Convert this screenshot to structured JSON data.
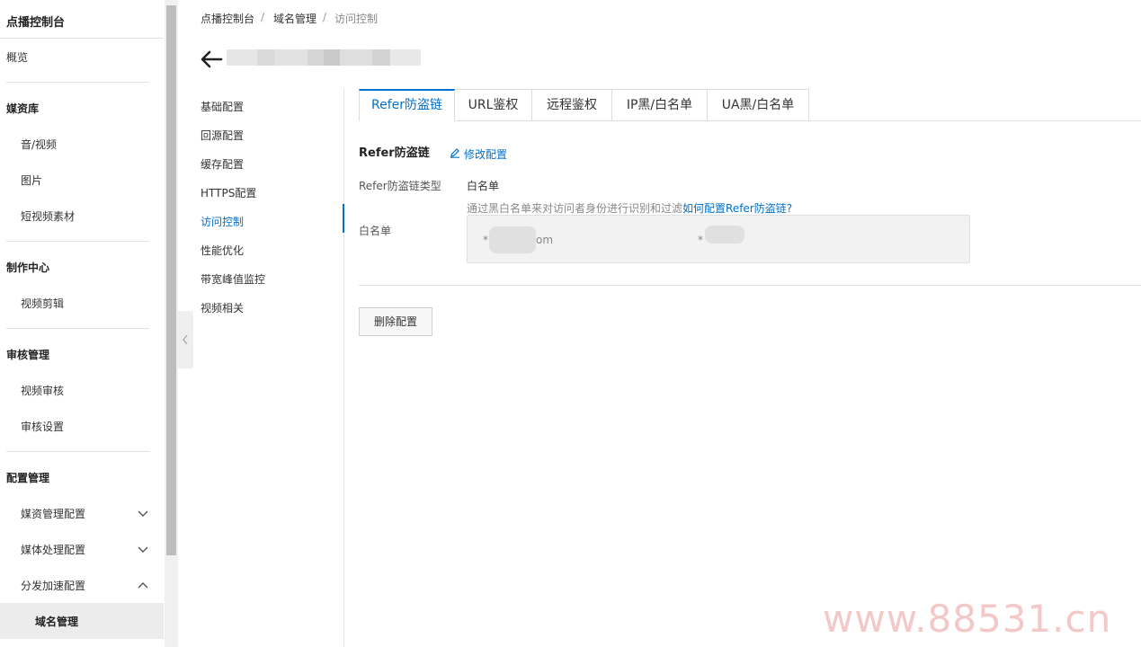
{
  "sidebar": {
    "title": "点播控制台",
    "overview": "概览",
    "groups": [
      {
        "label": "媒资库",
        "items": [
          "音/视频",
          "图片",
          "短视频素材"
        ]
      },
      {
        "label": "制作中心",
        "items": [
          "视频剪辑"
        ]
      },
      {
        "label": "审核管理",
        "items": [
          "视频审核",
          "审核设置"
        ]
      },
      {
        "label": "配置管理",
        "items": [
          "媒资管理配置",
          "媒体处理配置",
          "分发加速配置"
        ]
      }
    ],
    "active_item": "域名管理"
  },
  "breadcrumb": [
    "点播控制台",
    "域名管理",
    "访问控制"
  ],
  "breadcrumb_sep": "/",
  "sub_menu": [
    "基础配置",
    "回源配置",
    "缓存配置",
    "HTTPS配置",
    "访问控制",
    "性能优化",
    "带宽峰值监控",
    "视频相关"
  ],
  "sub_menu_active": "访问控制",
  "tabs": [
    "Refer防盗链",
    "URL鉴权",
    "远程鉴权",
    "IP黑/白名单",
    "UA黑/白名单"
  ],
  "active_tab": "Refer防盗链",
  "section": {
    "title": "Refer防盗链",
    "edit_label": "修改配置",
    "type_label": "Refer防盗链类型",
    "type_value": "白名单",
    "hint_text": "通过黑白名单来对访问者身份进行识别和过滤",
    "hint_link": "如何配置Refer防盗链?",
    "list_label": "白名单",
    "entries": [
      "*",
      "om",
      "*"
    ],
    "delete_label": "删除配置"
  },
  "watermark": "www.88531.cn",
  "colors": {
    "accent": "#0070cc",
    "watermark": "#f3c8c8"
  }
}
